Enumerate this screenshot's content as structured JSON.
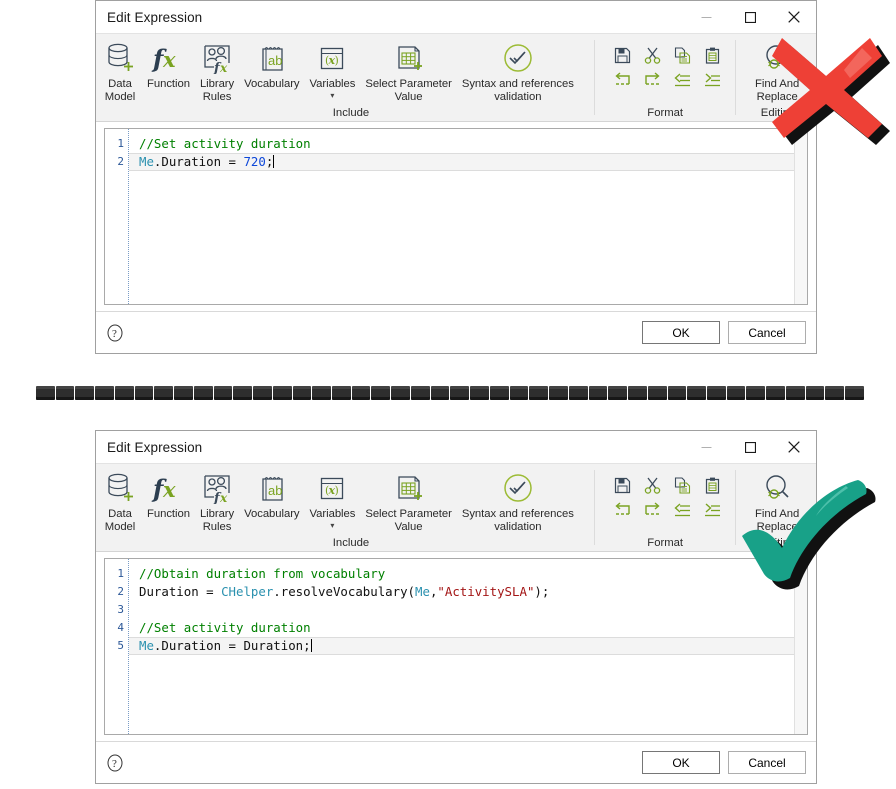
{
  "dialogs": [
    {
      "title": "Edit Expression",
      "window_controls": {
        "minimize": "minimize-icon",
        "maximize": "maximize-icon",
        "close": "close-icon"
      },
      "ribbon": {
        "buttons": [
          {
            "icon": "data-model-icon",
            "label": "Data\nModel"
          },
          {
            "icon": "function-fx-icon",
            "label": "Function"
          },
          {
            "icon": "library-rules-icon",
            "label": "Library\nRules"
          },
          {
            "icon": "vocabulary-icon",
            "label": "Vocabulary"
          },
          {
            "icon": "variables-icon",
            "label": "Variables",
            "caret": "▾"
          },
          {
            "icon": "select-parameter-icon",
            "label": "Select Parameter\nValue"
          },
          {
            "icon": "syntax-validation-icon",
            "label": "Syntax and references\nvalidation"
          }
        ],
        "include_caption": "Include",
        "format_caption": "Format",
        "editing_caption": "Editing",
        "format_icons": [
          "save-icon",
          "cut-icon",
          "copy-icon",
          "paste-icon",
          "undo-icon",
          "redo-icon",
          "outdent-icon",
          "indent-icon"
        ],
        "find_replace": {
          "icon": "find-replace-icon",
          "label": "Find And\nReplace"
        }
      },
      "editor": {
        "line_numbers": [
          "1",
          "2"
        ],
        "lines": [
          {
            "active": false,
            "tokens": [
              {
                "t": "comment",
                "v": "//Set activity duration"
              }
            ]
          },
          {
            "active": true,
            "tokens": [
              {
                "t": "type",
                "v": "Me"
              },
              {
                "t": "plain",
                "v": ".Duration = "
              },
              {
                "t": "num",
                "v": "720"
              },
              {
                "t": "plain",
                "v": ";"
              }
            ],
            "caret": true
          }
        ]
      },
      "footer": {
        "help": "help-icon",
        "ok": "OK",
        "cancel": "Cancel"
      },
      "mark": "red-x-mark"
    },
    {
      "title": "Edit Expression",
      "window_controls": {
        "minimize": "minimize-icon",
        "maximize": "maximize-icon",
        "close": "close-icon"
      },
      "ribbon": {
        "buttons": [
          {
            "icon": "data-model-icon",
            "label": "Data\nModel"
          },
          {
            "icon": "function-fx-icon",
            "label": "Function"
          },
          {
            "icon": "library-rules-icon",
            "label": "Library\nRules"
          },
          {
            "icon": "vocabulary-icon",
            "label": "Vocabulary"
          },
          {
            "icon": "variables-icon",
            "label": "Variables",
            "caret": "▾"
          },
          {
            "icon": "select-parameter-icon",
            "label": "Select Parameter\nValue"
          },
          {
            "icon": "syntax-validation-icon",
            "label": "Syntax and references\nvalidation"
          }
        ],
        "include_caption": "Include",
        "format_caption": "Format",
        "editing_caption": "Editing",
        "format_icons": [
          "save-icon",
          "cut-icon",
          "copy-icon",
          "paste-icon",
          "undo-icon",
          "redo-icon",
          "outdent-icon",
          "indent-icon"
        ],
        "find_replace": {
          "icon": "find-replace-icon",
          "label": "Find And\nReplace"
        }
      },
      "editor": {
        "line_numbers": [
          "1",
          "2",
          "3",
          "4",
          "5"
        ],
        "lines": [
          {
            "active": false,
            "tokens": [
              {
                "t": "comment",
                "v": "//Obtain duration from vocabulary"
              }
            ]
          },
          {
            "active": false,
            "tokens": [
              {
                "t": "plain",
                "v": "Duration = "
              },
              {
                "t": "type",
                "v": "CHelper"
              },
              {
                "t": "plain",
                "v": ".resolveVocabulary("
              },
              {
                "t": "type",
                "v": "Me"
              },
              {
                "t": "plain",
                "v": ","
              },
              {
                "t": "str",
                "v": "\"ActivitySLA\""
              },
              {
                "t": "plain",
                "v": ");"
              }
            ]
          },
          {
            "active": false,
            "tokens": [
              {
                "t": "plain",
                "v": ""
              }
            ]
          },
          {
            "active": false,
            "tokens": [
              {
                "t": "comment",
                "v": "//Set activity duration"
              }
            ]
          },
          {
            "active": true,
            "tokens": [
              {
                "t": "type",
                "v": "Me"
              },
              {
                "t": "plain",
                "v": ".Duration = Duration;"
              }
            ],
            "caret": true
          }
        ]
      },
      "footer": {
        "help": "help-icon",
        "ok": "OK",
        "cancel": "Cancel"
      },
      "mark": "green-check-mark"
    }
  ],
  "divider": {
    "name": "spiral-binding-divider",
    "coil_count": 42
  },
  "colors": {
    "icon_dark": "#3b4a5a",
    "icon_green": "#7aa322",
    "comment_green": "#008000",
    "type_teal": "#2b91af",
    "number_blue": "#0d47d9",
    "string_red": "#a31515",
    "mark_red": "#ee4036",
    "mark_green": "#18a188",
    "ribbon_bg": "#f2f2f2"
  }
}
